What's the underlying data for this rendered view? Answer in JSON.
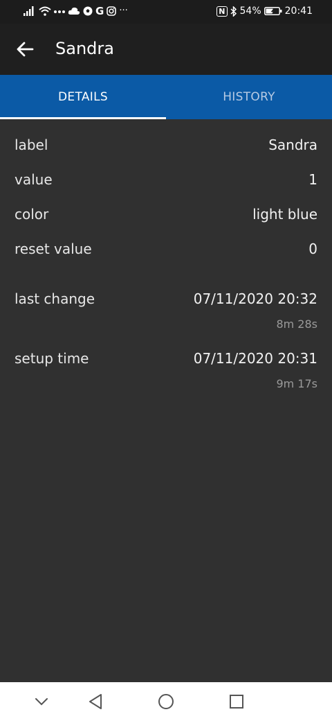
{
  "status_bar": {
    "left_icons": [
      "signal-icon",
      "wifi-icon",
      "dots-icon",
      "cloud-icon",
      "soccer-icon",
      "google-icon",
      "instagram-icon",
      "more-icon"
    ],
    "google_letter": "G",
    "more": "···",
    "nfc": "N",
    "battery_percent": "54%",
    "time": "20:41"
  },
  "app_bar": {
    "title": "Sandra"
  },
  "tabs": [
    {
      "label": "DETAILS",
      "active": true
    },
    {
      "label": "HISTORY",
      "active": false
    }
  ],
  "details": [
    {
      "key": "label",
      "value": "Sandra"
    },
    {
      "key": "value",
      "value": "1"
    },
    {
      "key": "color",
      "value": "light blue"
    },
    {
      "key": "reset value",
      "value": "0"
    },
    {
      "key": "last change",
      "value": "07/11/2020 20:32",
      "sub": "8m 28s"
    },
    {
      "key": "setup time",
      "value": "07/11/2020 20:31",
      "sub": "9m 17s"
    }
  ],
  "colors": {
    "background": "#303030",
    "app_bar": "#1f1f1f",
    "tab_bar": "#0b5aa6",
    "secondary_text": "#9a9a9a"
  }
}
